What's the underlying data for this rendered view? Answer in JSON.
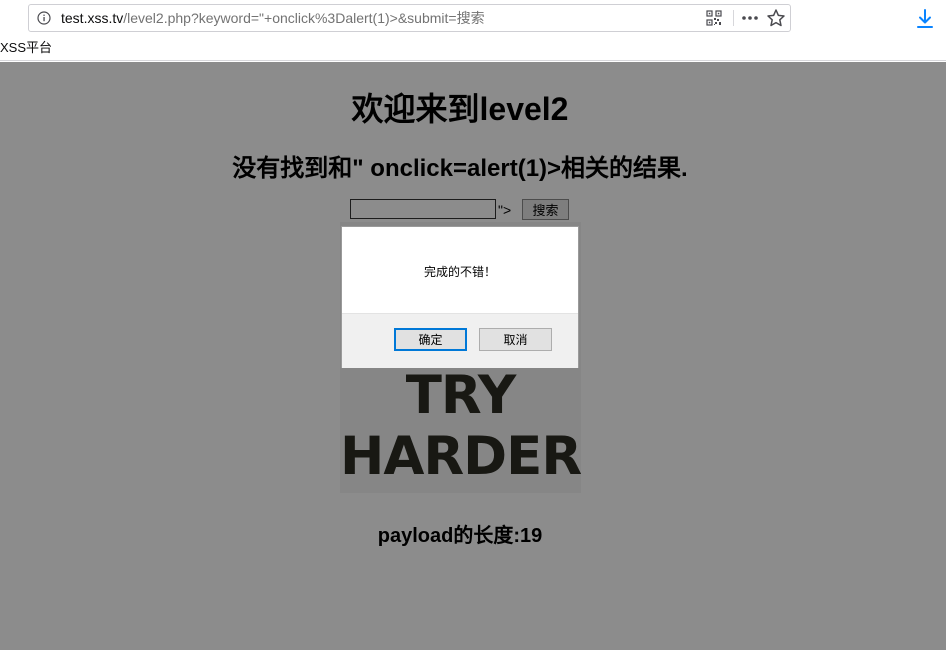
{
  "browser": {
    "url_host": "test.xss.tv",
    "url_path": "/level2.php?keyword=\"+onclick%3Dalert(1)>&submit=搜索",
    "bookmarks": [
      {
        "label": "XSS平台"
      }
    ]
  },
  "page": {
    "title": "欢迎来到level2",
    "result": "没有找到和\" onclick=alert(1)>相关的结果.",
    "search_value": "",
    "leak_text": "\">",
    "search_button": "搜索",
    "image_line1": "TRY",
    "image_line2": "HARDER",
    "payload_length": "payload的长度:19"
  },
  "dialog": {
    "message": "完成的不错！",
    "ok_label": "确定",
    "cancel_label": "取消"
  },
  "colors": {
    "accent": "#0078d7",
    "overlay": "#8c8c8c",
    "image_text": "#2c2c24"
  }
}
